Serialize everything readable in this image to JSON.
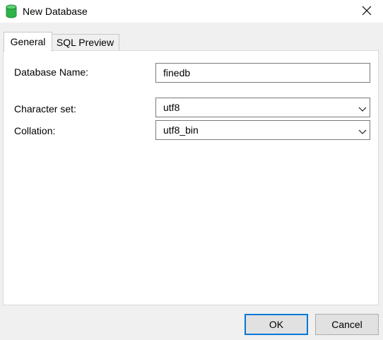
{
  "window": {
    "title": "New Database",
    "icon": "database-icon",
    "close_icon": "close-icon"
  },
  "tabs": [
    {
      "label": "General",
      "active": true
    },
    {
      "label": "SQL Preview",
      "active": false
    }
  ],
  "form": {
    "database_name": {
      "label": "Database Name:",
      "value": "finedb"
    },
    "character_set": {
      "label": "Character set:",
      "value": "utf8"
    },
    "collation": {
      "label": "Collation:",
      "value": "utf8_bin"
    }
  },
  "buttons": {
    "ok": "OK",
    "cancel": "Cancel"
  },
  "colors": {
    "icon_green": "#2db34a",
    "default_button_border": "#0078d7"
  }
}
